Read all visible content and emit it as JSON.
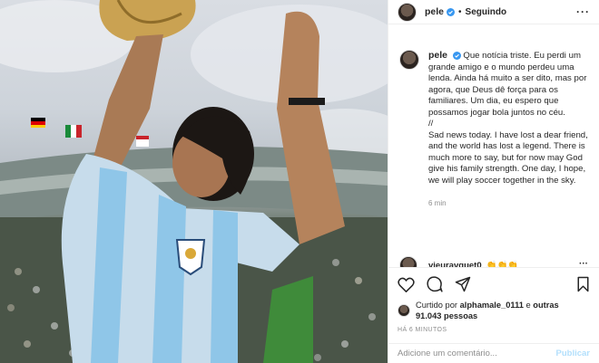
{
  "header": {
    "username": "pele",
    "separator": "•",
    "follow_status": "Seguindo",
    "more": "···"
  },
  "caption": {
    "username": "pele",
    "paragraph_pt": "Que notícia triste. Eu perdi um grande amigo e o mundo perdeu uma lenda. Ainda há muito a ser dito, mas por agora, que Deus dê força para os familiares. Um dia, eu espero que possamos jogar bola juntos no céu.",
    "divider": "//",
    "paragraph_en": "Sad news today. I have lost a dear friend, and the world has lost a legend. There is much more to say, but for now may God give his family strength. One day, I hope, we will play soccer together in the sky.",
    "time": "6 min"
  },
  "comment_peek": {
    "username": "vieuravquet0",
    "emoji": "👏👏👏",
    "more": "···"
  },
  "icons": {
    "like": "heart-icon",
    "comment": "comment-icon",
    "share": "share-icon",
    "save": "bookmark-icon"
  },
  "likes": {
    "prefix": "Curtido por",
    "user": "alphamale_0111",
    "and": "e",
    "others": "outras 91.043 pessoas"
  },
  "posted_ago": "HÁ 6 MINUTOS",
  "comment_box": {
    "placeholder": "Adicione um comentário...",
    "publish": "Publicar"
  },
  "colors": {
    "verified": "#3897f0",
    "text": "#262626",
    "muted": "#8e8e8e",
    "publish_disabled": "#b2dffc",
    "shirt_blue": "#8fc6e8"
  }
}
